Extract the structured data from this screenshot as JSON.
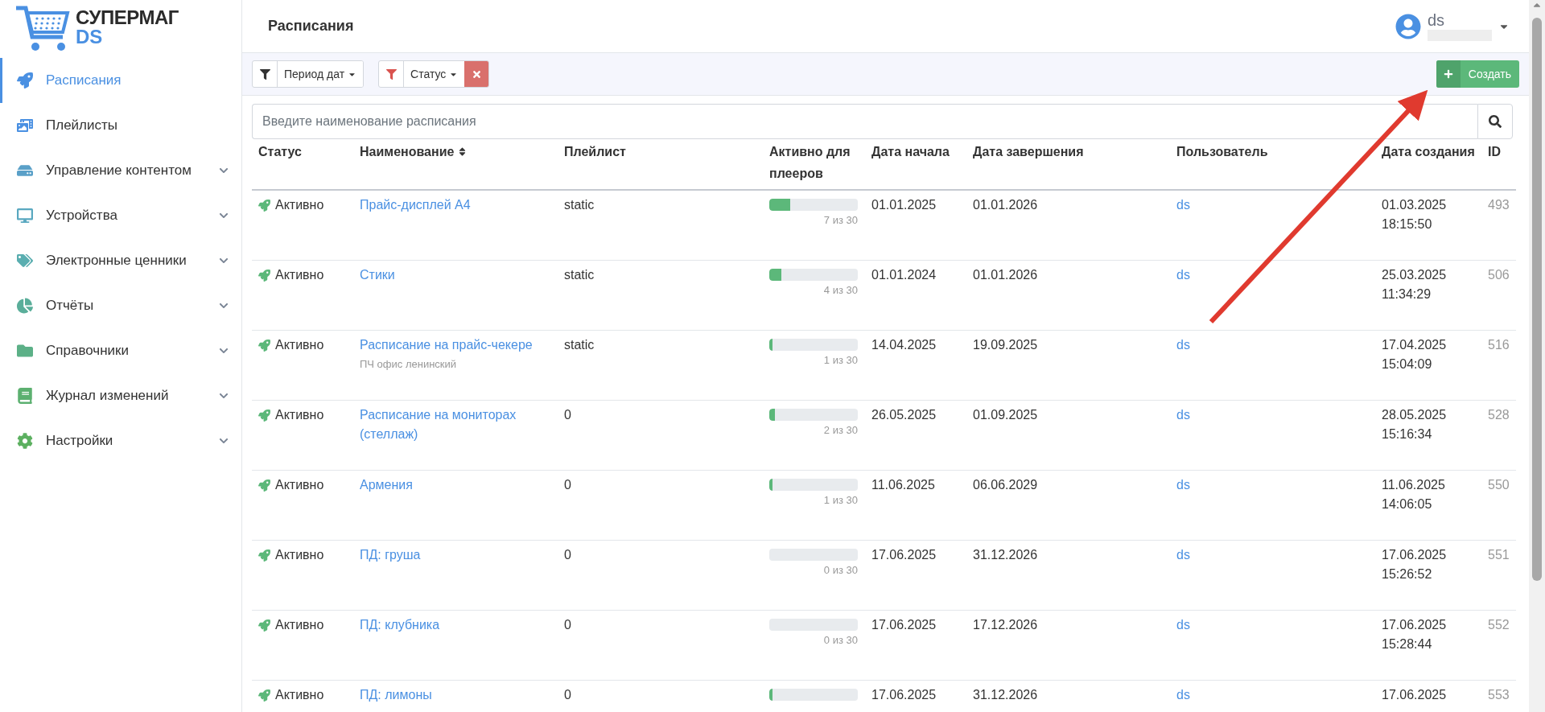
{
  "brand": {
    "name": "СУПЕРМАГ",
    "sub": "DS"
  },
  "sidebar": {
    "items": [
      {
        "label": "Расписания",
        "selected": true,
        "has_submenu": false
      },
      {
        "label": "Плейлисты",
        "selected": false,
        "has_submenu": false
      },
      {
        "label": "Управление контентом",
        "selected": false,
        "has_submenu": true
      },
      {
        "label": "Устройства",
        "selected": false,
        "has_submenu": true
      },
      {
        "label": "Электронные ценники",
        "selected": false,
        "has_submenu": true
      },
      {
        "label": "Отчёты",
        "selected": false,
        "has_submenu": true
      },
      {
        "label": "Справочники",
        "selected": false,
        "has_submenu": true
      },
      {
        "label": "Журнал изменений",
        "selected": false,
        "has_submenu": true
      },
      {
        "label": "Настройки",
        "selected": false,
        "has_submenu": true
      }
    ]
  },
  "header": {
    "title": "Расписания",
    "user": "ds"
  },
  "filters": [
    {
      "label": "Период дат",
      "active": false
    },
    {
      "label": "Статус",
      "active": true
    }
  ],
  "create_button": "Создать",
  "search": {
    "placeholder": "Введите наименование расписания"
  },
  "table": {
    "columns": [
      "Статус",
      "Наименование",
      "Плейлист",
      "Активно для плееров",
      "Дата начала",
      "Дата завершения",
      "Пользователь",
      "Дата создания",
      "ID"
    ],
    "rows": [
      {
        "status": "Активно",
        "name": "Прайс-дисплей А4",
        "playlist": "static",
        "level": 0.233,
        "players": "7 из 30",
        "start": "01.01.2025",
        "end": "01.01.2026",
        "user": "ds",
        "created_date": "01.03.2025",
        "created_time": "18:15:50",
        "id": "493"
      },
      {
        "status": "Активно",
        "name": "Стики",
        "playlist": "static",
        "level": 0.133,
        "players": "4 из 30",
        "start": "01.01.2024",
        "end": "01.01.2026",
        "user": "ds",
        "created_date": "25.03.2025",
        "created_time": "11:34:29",
        "id": "506"
      },
      {
        "status": "Активно",
        "name": "Расписание на прайс-чекере",
        "note": "ПЧ офис ленинский",
        "playlist": "static",
        "level": 0.033,
        "players": "1 из 30",
        "start": "14.04.2025",
        "end": "19.09.2025",
        "user": "ds",
        "created_date": "17.04.2025",
        "created_time": "15:04:09",
        "id": "516"
      },
      {
        "status": "Активно",
        "name": "Расписание на мониторах (стеллаж)",
        "playlist": "0",
        "level": 0.067,
        "players": "2 из 30",
        "start": "26.05.2025",
        "end": "01.09.2025",
        "user": "ds",
        "created_date": "28.05.2025",
        "created_time": "15:16:34",
        "id": "528"
      },
      {
        "status": "Активно",
        "name": "Армения",
        "playlist": "0",
        "level": 0.033,
        "players": "1 из 30",
        "start": "11.06.2025",
        "end": "06.06.2029",
        "user": "ds",
        "created_date": "11.06.2025",
        "created_time": "14:06:05",
        "id": "550"
      },
      {
        "status": "Активно",
        "name": "ПД: груша",
        "playlist": "0",
        "level": 0,
        "players": "0 из 30",
        "start": "17.06.2025",
        "end": "31.12.2026",
        "user": "ds",
        "created_date": "17.06.2025",
        "created_time": "15:26:52",
        "id": "551"
      },
      {
        "status": "Активно",
        "name": "ПД: клубника",
        "playlist": "0",
        "level": 0,
        "players": "0 из 30",
        "start": "17.06.2025",
        "end": "17.12.2026",
        "user": "ds",
        "created_date": "17.06.2025",
        "created_time": "15:28:44",
        "id": "552"
      },
      {
        "status": "Активно",
        "name": "ПД: лимоны",
        "playlist": "0",
        "level": 0.033,
        "start": "17.06.2025",
        "end": "31.12.2026",
        "user": "ds",
        "created_date": "17.06.2025",
        "id": "553"
      }
    ]
  }
}
